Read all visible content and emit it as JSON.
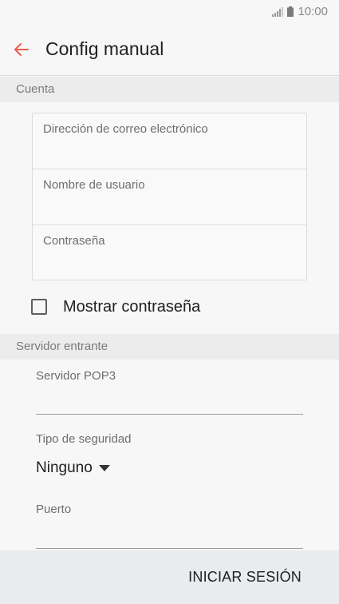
{
  "status_bar": {
    "time": "10:00",
    "icons": [
      "signal-icon",
      "battery-icon"
    ]
  },
  "app_bar": {
    "title": "Config manual",
    "back_icon": "arrow-left-icon",
    "accent_color": "#e8604c"
  },
  "account_section": {
    "header": "Cuenta",
    "fields": [
      {
        "placeholder": "Dirección de correo electrónico",
        "value": ""
      },
      {
        "placeholder": "Nombre de usuario",
        "value": ""
      },
      {
        "placeholder": "Contraseña",
        "value": ""
      }
    ],
    "show_password": {
      "label": "Mostrar contraseña",
      "checked": false
    }
  },
  "incoming_server_section": {
    "header": "Servidor entrante",
    "pop3_server": {
      "label": "Servidor POP3",
      "value": ""
    },
    "security_type": {
      "label": "Tipo de seguridad",
      "selected": "Ninguno"
    },
    "port": {
      "label": "Puerto",
      "value": ""
    }
  },
  "bottom_bar": {
    "login_label": "INICIAR SESIÓN"
  }
}
